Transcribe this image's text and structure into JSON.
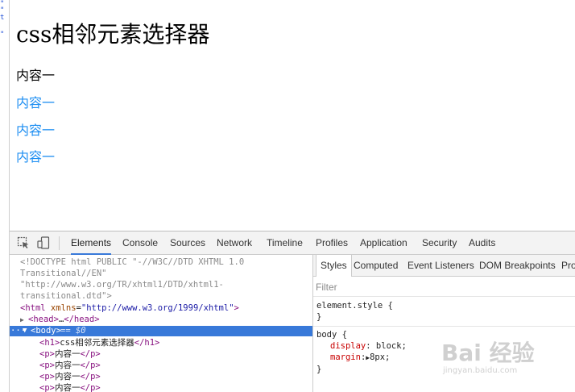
{
  "left_strip": {
    "glyphs": [
      "\"",
      "\"",
      "t",
      "\""
    ]
  },
  "page": {
    "heading": "css相邻元素选择器",
    "paragraphs": [
      "内容一",
      "内容一",
      "内容一",
      "内容一"
    ],
    "accent_color": "#1d8ef2"
  },
  "devtools": {
    "tools": {
      "inspect": "inspect-icon",
      "device": "device-mode-icon"
    },
    "tabs": [
      "Elements",
      "Console",
      "Sources",
      "Network",
      "Timeline",
      "Profiles",
      "Application",
      "Security",
      "Audits"
    ],
    "active_tab": "Elements",
    "elements": {
      "doctype_lines": [
        "<!DOCTYPE html PUBLIC \"-//W3C//DTD XHTML 1.0",
        "Transitional//EN\"",
        "\"http://www.w3.org/TR/xhtml1/DTD/xhtml1-",
        "transitional.dtd\">"
      ],
      "html_open": {
        "tag_open": "<html",
        "attr": " xmlns",
        "eq": "=",
        "value": "\"http://www.w3.org/1999/xhtml\"",
        "tag_close": ">"
      },
      "head_collapsed": {
        "tag": "<head>",
        "ellipsis": "…",
        "close": "</head>"
      },
      "selected": {
        "dots": "···",
        "arrow": "▼",
        "tag": "<body>",
        "suffix": " == $0"
      },
      "children": [
        {
          "open": "<h1>",
          "text": "css相邻元素选择器",
          "close": "</h1>"
        },
        {
          "open": "<p>",
          "text": "内容一",
          "close": "</p>"
        },
        {
          "open": "<p>",
          "text": "内容一",
          "close": "</p>"
        },
        {
          "open": "<p>",
          "text": "内容一",
          "close": "</p>"
        },
        {
          "open": "<p>",
          "text": "内容一",
          "close": "</p>"
        }
      ]
    },
    "styles": {
      "tabs": [
        "Styles",
        "Computed",
        "Event Listeners",
        "DOM Breakpoints",
        "Pro"
      ],
      "active_tab": "Styles",
      "filter_placeholder": "Filter",
      "element_style": {
        "selector": "element.style {",
        "close": "}"
      },
      "body_rule": {
        "selector": "body {",
        "declarations": [
          {
            "prop": "display",
            "colon": ": ",
            "value": "block;"
          },
          {
            "prop": "margin",
            "colon": ":",
            "arrow": "▶",
            "value": "8px;"
          }
        ],
        "close": "}"
      }
    }
  },
  "watermark": {
    "brand": "Bai 经验",
    "url": "jingyan.baidu.com"
  }
}
